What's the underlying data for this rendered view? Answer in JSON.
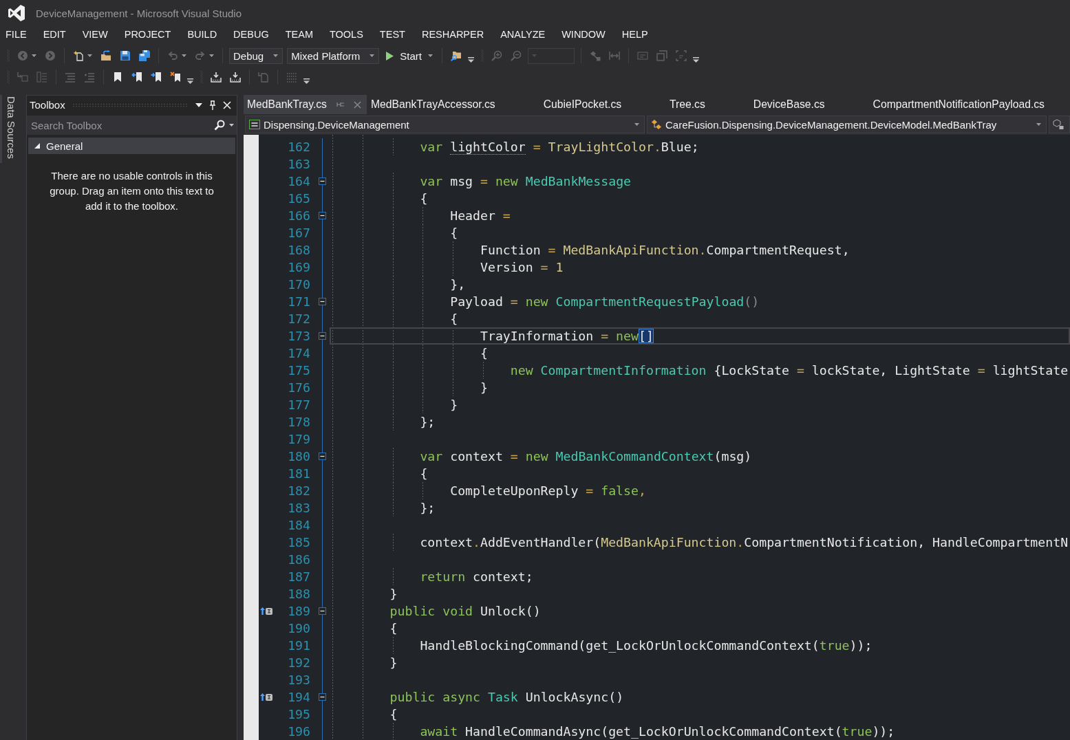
{
  "window": {
    "title": "DeviceManagement - Microsoft Visual Studio"
  },
  "menu": [
    {
      "label": "FILE"
    },
    {
      "label": "EDIT"
    },
    {
      "label": "VIEW"
    },
    {
      "label": "PROJECT"
    },
    {
      "label": "BUILD"
    },
    {
      "label": "DEBUG"
    },
    {
      "label": "TEAM"
    },
    {
      "label": "TOOLS"
    },
    {
      "label": "TEST"
    },
    {
      "label": "RESHARPER"
    },
    {
      "label": "ANALYZE"
    },
    {
      "label": "WINDOW"
    },
    {
      "label": "HELP"
    }
  ],
  "toolbar_rows": [
    {
      "bands": [
        {
          "groups": [
            [
              {
                "kind": "button",
                "disabled": true,
                "dropdown": true
              },
              {
                "kind": "button",
                "disabled": true,
                "dropdown": false
              }
            ],
            [
              {
                "kind": "button",
                "disabled": false,
                "dropdown": true
              },
              {
                "kind": "button",
                "disabled": false,
                "dropdown": false
              },
              {
                "kind": "button",
                "disabled": false,
                "dropdown": false
              },
              {
                "kind": "button",
                "disabled": false,
                "dropdown": false
              }
            ],
            [
              {
                "kind": "button",
                "disabled": true,
                "dropdown": true
              },
              {
                "kind": "button",
                "disabled": true,
                "dropdown": true
              }
            ],
            [
              {
                "kind": "combo",
                "value": "Debug",
                "disabled": false
              },
              {
                "kind": "combo",
                "value": "Mixed Platform",
                "disabled": false
              },
              {
                "kind": "run",
                "label": "Start",
                "dropdown": true
              }
            ],
            [
              {
                "kind": "button",
                "disabled": false,
                "dropdown": false
              },
              {
                "kind": "overflow"
              }
            ]
          ]
        },
        {
          "groups": [
            [
              {
                "kind": "button",
                "disabled": true,
                "dropdown": false
              },
              {
                "kind": "button",
                "disabled": true,
                "dropdown": false
              },
              {
                "kind": "combo",
                "disabled": true
              }
            ],
            [
              {
                "kind": "button",
                "disabled": true,
                "dropdown": false
              },
              {
                "kind": "button",
                "disabled": true,
                "dropdown": false
              }
            ],
            [
              {
                "kind": "button",
                "disabled": true,
                "dropdown": false
              },
              {
                "kind": "button",
                "disabled": true,
                "dropdown": false
              },
              {
                "kind": "button",
                "disabled": true,
                "dropdown": false
              },
              {
                "kind": "overflow"
              }
            ]
          ]
        }
      ]
    },
    {
      "bands": [
        {
          "groups": [
            [
              {
                "kind": "button",
                "disabled": true,
                "dropdown": false
              },
              {
                "kind": "button",
                "disabled": true,
                "dropdown": false
              }
            ],
            [
              {
                "kind": "button",
                "disabled": true,
                "dropdown": false
              },
              {
                "kind": "button",
                "disabled": true,
                "dropdown": false
              }
            ],
            [
              {
                "kind": "button",
                "disabled": false,
                "dropdown": false
              },
              {
                "kind": "button",
                "disabled": false,
                "dropdown": false
              },
              {
                "kind": "button",
                "disabled": false,
                "dropdown": false
              },
              {
                "kind": "button",
                "disabled": false,
                "dropdown": false
              },
              {
                "kind": "overflow"
              }
            ]
          ]
        },
        {
          "groups": [
            [
              {
                "kind": "button",
                "disabled": false,
                "dropdown": false
              },
              {
                "kind": "button",
                "disabled": false,
                "dropdown": false
              }
            ],
            [
              {
                "kind": "button",
                "disabled": true,
                "dropdown": false
              }
            ],
            [
              {
                "kind": "button",
                "disabled": true,
                "dropdown": false
              },
              {
                "kind": "overflow"
              }
            ]
          ]
        }
      ]
    }
  ],
  "side_tabs": [
    {
      "label": "Data Sources"
    }
  ],
  "toolbox": {
    "title": "Toolbox",
    "search": {
      "placeholder": "Search Toolbox"
    },
    "groups": [
      {
        "label": "General",
        "expanded": true,
        "message": "There are no usable controls in this group. Drag an item onto this text to add it to the toolbox."
      }
    ]
  },
  "editor": {
    "tabs": [
      {
        "label": "MedBankTray.cs",
        "selected": true
      },
      {
        "label": "MedBankTrayAccessor.cs",
        "selected": false
      },
      {
        "label": "CubieIPocket.cs",
        "selected": false
      },
      {
        "label": "Tree.cs",
        "selected": false
      },
      {
        "label": "DeviceBase.cs",
        "selected": false
      },
      {
        "label": "CompartmentNotificationPayload.cs",
        "selected": false
      }
    ],
    "navigation_bar": {
      "project": "Dispensing.DeviceManagement",
      "type": "CareFusion.Dispensing.DeviceManagement.DeviceModel.MedBankTray"
    },
    "code_lines": [
      {
        "number": "162",
        "collapsible": false,
        "marker": false,
        "current": false,
        "tokens": [
          {
            "kind": "keyword",
            "text": "            var "
          },
          {
            "kind": "hint",
            "text": "lightColor"
          },
          {
            "kind": "op",
            "text": " = "
          },
          {
            "kind": "enum",
            "text": "TrayLightColor"
          },
          {
            "kind": "op",
            "text": "."
          },
          {
            "kind": "plain",
            "text": "Blue;"
          }
        ]
      },
      {
        "number": "163",
        "collapsible": false,
        "marker": false,
        "current": false
      },
      {
        "number": "164",
        "collapsible": true,
        "marker": false,
        "current": false,
        "tokens": [
          {
            "kind": "keyword",
            "text": "            var"
          },
          {
            "kind": "plain",
            "text": " msg "
          },
          {
            "kind": "op",
            "text": "= "
          },
          {
            "kind": "keyword",
            "text": "new "
          },
          {
            "kind": "type",
            "text": "MedBankMessage"
          }
        ]
      },
      {
        "number": "165",
        "collapsible": false,
        "marker": false,
        "current": false,
        "tokens": [
          {
            "kind": "plain",
            "text": "            {"
          }
        ]
      },
      {
        "number": "166",
        "collapsible": true,
        "marker": false,
        "current": false,
        "tokens": [
          {
            "kind": "plain",
            "text": "                Header "
          },
          {
            "kind": "op",
            "text": "="
          }
        ]
      },
      {
        "number": "167",
        "collapsible": false,
        "marker": false,
        "current": false,
        "tokens": [
          {
            "kind": "plain",
            "text": "                {"
          }
        ]
      },
      {
        "number": "168",
        "collapsible": false,
        "marker": false,
        "current": false,
        "tokens": [
          {
            "kind": "plain",
            "text": "                    Function "
          },
          {
            "kind": "op",
            "text": "= "
          },
          {
            "kind": "enum",
            "text": "MedBankApiFunction"
          },
          {
            "kind": "op",
            "text": "."
          },
          {
            "kind": "plain",
            "text": "CompartmentRequest,"
          }
        ]
      },
      {
        "number": "169",
        "collapsible": false,
        "marker": false,
        "current": false,
        "tokens": [
          {
            "kind": "plain",
            "text": "                    Version "
          },
          {
            "kind": "op",
            "text": "= "
          },
          {
            "kind": "number",
            "text": "1"
          }
        ]
      },
      {
        "number": "170",
        "collapsible": false,
        "marker": false,
        "current": false,
        "tokens": [
          {
            "kind": "plain",
            "text": "                },"
          }
        ]
      },
      {
        "number": "171",
        "collapsible": true,
        "marker": false,
        "current": false,
        "tokens": [
          {
            "kind": "plain",
            "text": "                Payload "
          },
          {
            "kind": "op",
            "text": "= "
          },
          {
            "kind": "keyword",
            "text": "new "
          },
          {
            "kind": "type",
            "text": "CompartmentRequestPayload"
          },
          {
            "kind": "dim",
            "text": "()"
          }
        ]
      },
      {
        "number": "172",
        "collapsible": false,
        "marker": false,
        "current": false,
        "tokens": [
          {
            "kind": "plain",
            "text": "                {"
          }
        ]
      },
      {
        "number": "173",
        "collapsible": true,
        "marker": false,
        "current": true,
        "tokens": [
          {
            "kind": "plain",
            "text": "                    TrayInformation "
          },
          {
            "kind": "op",
            "text": "= "
          },
          {
            "kind": "keyword",
            "text": "new"
          },
          {
            "kind": "match",
            "text": "[]"
          }
        ]
      },
      {
        "number": "174",
        "collapsible": false,
        "marker": false,
        "current": false,
        "tokens": [
          {
            "kind": "plain",
            "text": "                    {"
          }
        ]
      },
      {
        "number": "175",
        "collapsible": false,
        "marker": false,
        "current": false,
        "tokens": [
          {
            "kind": "keyword",
            "text": "                        new "
          },
          {
            "kind": "type",
            "text": "CompartmentInformation"
          },
          {
            "kind": "plain",
            "text": " {LockState "
          },
          {
            "kind": "op",
            "text": "="
          },
          {
            "kind": "plain",
            "text": " lockState, LightState "
          },
          {
            "kind": "op",
            "text": "="
          },
          {
            "kind": "plain",
            "text": " lightState"
          }
        ]
      },
      {
        "number": "176",
        "collapsible": false,
        "marker": false,
        "current": false,
        "tokens": [
          {
            "kind": "plain",
            "text": "                    }"
          }
        ]
      },
      {
        "number": "177",
        "collapsible": false,
        "marker": false,
        "current": false,
        "tokens": [
          {
            "kind": "plain",
            "text": "                }"
          }
        ]
      },
      {
        "number": "178",
        "collapsible": false,
        "marker": false,
        "current": false,
        "tokens": [
          {
            "kind": "plain",
            "text": "            };"
          }
        ]
      },
      {
        "number": "179",
        "collapsible": false,
        "marker": false,
        "current": false
      },
      {
        "number": "180",
        "collapsible": true,
        "marker": false,
        "current": false,
        "tokens": [
          {
            "kind": "keyword",
            "text": "            var"
          },
          {
            "kind": "plain",
            "text": " context "
          },
          {
            "kind": "op",
            "text": "= "
          },
          {
            "kind": "keyword",
            "text": "new "
          },
          {
            "kind": "type",
            "text": "MedBankCommandContext"
          },
          {
            "kind": "plain",
            "text": "(msg)"
          }
        ]
      },
      {
        "number": "181",
        "collapsible": false,
        "marker": false,
        "current": false,
        "tokens": [
          {
            "kind": "plain",
            "text": "            {"
          }
        ]
      },
      {
        "number": "182",
        "collapsible": false,
        "marker": false,
        "current": false,
        "tokens": [
          {
            "kind": "plain",
            "text": "                CompleteUponReply "
          },
          {
            "kind": "op",
            "text": "= "
          },
          {
            "kind": "keyword",
            "text": "false"
          },
          {
            "kind": "op",
            "text": ","
          }
        ]
      },
      {
        "number": "183",
        "collapsible": false,
        "marker": false,
        "current": false,
        "tokens": [
          {
            "kind": "plain",
            "text": "            };"
          }
        ]
      },
      {
        "number": "184",
        "collapsible": false,
        "marker": false,
        "current": false
      },
      {
        "number": "185",
        "collapsible": false,
        "marker": false,
        "current": false,
        "tokens": [
          {
            "kind": "plain",
            "text": "            context"
          },
          {
            "kind": "op",
            "text": "."
          },
          {
            "kind": "plain",
            "text": "AddEventHandler("
          },
          {
            "kind": "enum",
            "text": "MedBankApiFunction"
          },
          {
            "kind": "op",
            "text": "."
          },
          {
            "kind": "plain",
            "text": "CompartmentNotification, HandleCompartmentN"
          }
        ]
      },
      {
        "number": "186",
        "collapsible": false,
        "marker": false,
        "current": false
      },
      {
        "number": "187",
        "collapsible": false,
        "marker": false,
        "current": false,
        "tokens": [
          {
            "kind": "keyword",
            "text": "            return"
          },
          {
            "kind": "plain",
            "text": " context;"
          }
        ]
      },
      {
        "number": "188",
        "collapsible": false,
        "marker": false,
        "current": false,
        "tokens": [
          {
            "kind": "plain",
            "text": "        }"
          }
        ]
      },
      {
        "number": "189",
        "collapsible": true,
        "marker": true,
        "current": false,
        "tokens": [
          {
            "kind": "keyword",
            "text": "        public void"
          },
          {
            "kind": "plain",
            "text": " Unlock()"
          }
        ]
      },
      {
        "number": "190",
        "collapsible": false,
        "marker": false,
        "current": false,
        "tokens": [
          {
            "kind": "plain",
            "text": "        {"
          }
        ]
      },
      {
        "number": "191",
        "collapsible": false,
        "marker": false,
        "current": false,
        "tokens": [
          {
            "kind": "plain",
            "text": "            HandleBlockingCommand(get_LockOrUnlockCommandContext("
          },
          {
            "kind": "keyword",
            "text": "true"
          },
          {
            "kind": "plain",
            "text": "));"
          }
        ]
      },
      {
        "number": "192",
        "collapsible": false,
        "marker": false,
        "current": false,
        "tokens": [
          {
            "kind": "plain",
            "text": "        }"
          }
        ]
      },
      {
        "number": "193",
        "collapsible": false,
        "marker": false,
        "current": false
      },
      {
        "number": "194",
        "collapsible": true,
        "marker": true,
        "current": false,
        "tokens": [
          {
            "kind": "keyword",
            "text": "        public async "
          },
          {
            "kind": "type",
            "text": "Task"
          },
          {
            "kind": "plain",
            "text": " UnlockAsync()"
          }
        ]
      },
      {
        "number": "195",
        "collapsible": false,
        "marker": false,
        "current": false,
        "tokens": [
          {
            "kind": "plain",
            "text": "        {"
          }
        ]
      },
      {
        "number": "196",
        "collapsible": false,
        "marker": false,
        "current": false,
        "tokens": [
          {
            "kind": "keyword",
            "text": "            await"
          },
          {
            "kind": "plain",
            "text": " HandleCommandAsync(get_LockOrUnlockCommandContext("
          },
          {
            "kind": "keyword",
            "text": "true"
          },
          {
            "kind": "plain",
            "text": "));"
          }
        ]
      }
    ]
  }
}
